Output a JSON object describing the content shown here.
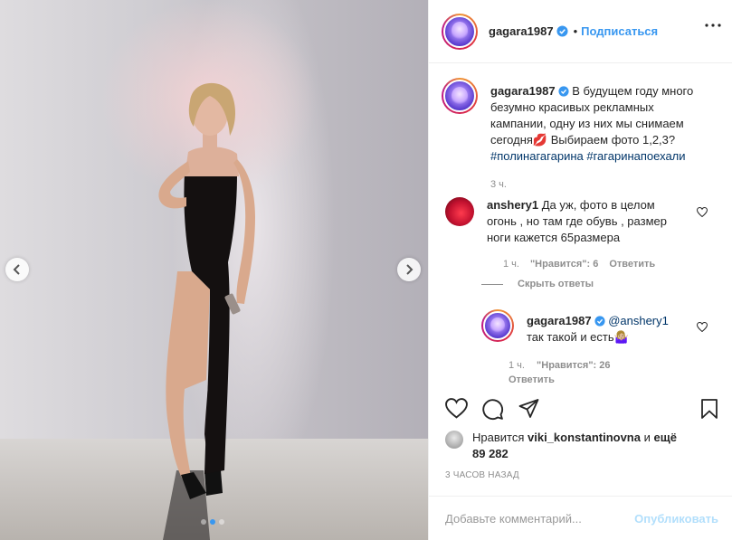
{
  "post": {
    "dots": [
      false,
      true,
      false
    ]
  },
  "header": {
    "username": "gagara1987",
    "follow_label": "Подписаться",
    "dot": "•",
    "verified_color": "#3897f0"
  },
  "caption": {
    "username": "gagara1987",
    "text": "В будущем году много безумно красивых рекламных кампании, одну из них мы снимаем сегодня💋 Выбираем фото 1,2,3?",
    "tag1": "#полинагагарина",
    "tag2": "#гагаринапоехали",
    "time": "3 ч."
  },
  "comments": [
    {
      "username": "anshery1",
      "text": "Да уж, фото в целом огонь , но там где обувь , размер ноги кажется 65размера",
      "time": "1 ч.",
      "likes": "\"Нравится\": 6",
      "reply_label": "Ответить"
    }
  ],
  "hide_replies_label": "Скрыть ответы",
  "reply": {
    "username": "gagara1987",
    "mention": "@anshery1",
    "text": "так такой и есть🤷🏼‍♀️",
    "time": "1 ч.",
    "likes": "\"Нравится\": 26",
    "reply_label": "Ответить"
  },
  "likes": {
    "prefix": "Нравится",
    "user": "viki_konstantinovna",
    "middle": "и",
    "count": "ещё 89 282"
  },
  "time_ago": "3 ЧАСОВ НАЗАД",
  "add_comment": {
    "placeholder": "Добавьте комментарий...",
    "publish_label": "Опубликовать"
  },
  "colors": {
    "accent": "#3897f0",
    "tag": "#003569",
    "meta": "#8e8e8e",
    "publish_disabled": "#b2dffc"
  }
}
